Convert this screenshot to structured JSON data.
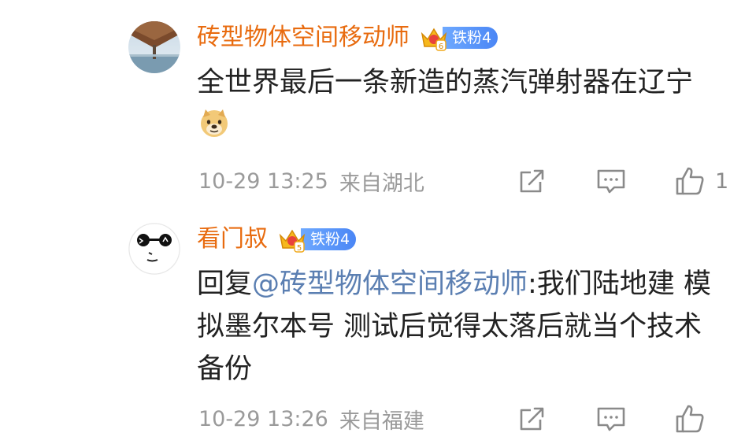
{
  "comments": [
    {
      "username": "砖型物体空间移动师",
      "fan_badge": {
        "crown_level": "6",
        "label": "铁粉4"
      },
      "content": "全世界最后一条新造的蒸汽弹射器在辽宁",
      "emoji": "doge-emoji",
      "time": "10-29 13:25",
      "location": "来自湖北",
      "like_count": "1"
    },
    {
      "username": "看门叔",
      "fan_badge": {
        "crown_level": "5",
        "label": "铁粉4"
      },
      "reply_prefix": "回复",
      "mention": "@砖型物体空间移动师",
      "content": ":我们陆地建 模拟墨尔本号 测试后觉得太落后就当个技术备份",
      "time": "10-29 13:26",
      "location": "来自福建",
      "like_count": ""
    }
  ],
  "colors": {
    "username": "#e86b0f",
    "mention": "#5b7fb2",
    "meta": "#9a9a9a",
    "badge_blue": "#4a86f5",
    "icon_gray": "#8a8a8a"
  },
  "icons": [
    "share-icon",
    "comment-icon",
    "like-icon",
    "crown-badge-icon",
    "doge-emoji"
  ]
}
